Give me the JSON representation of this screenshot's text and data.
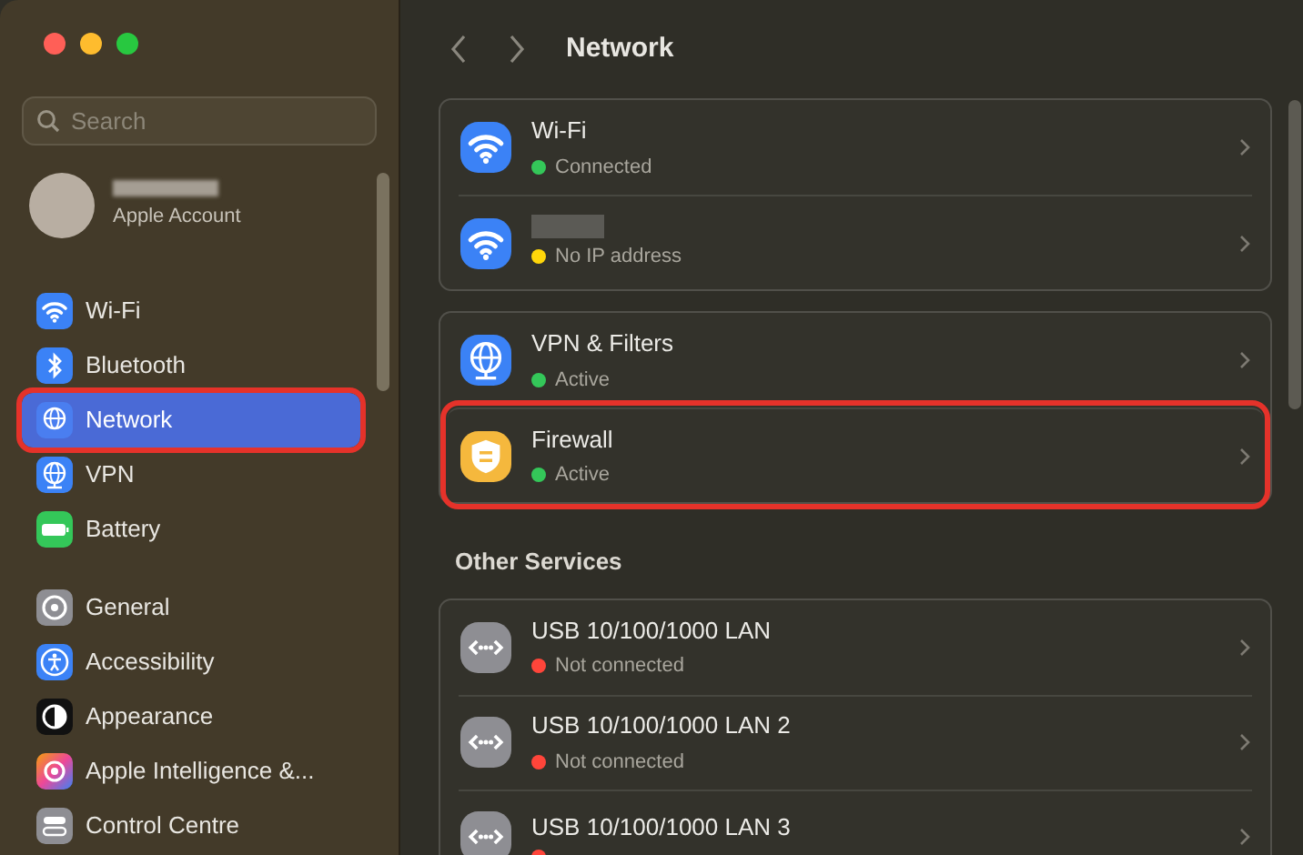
{
  "search": {
    "placeholder": "Search"
  },
  "account": {
    "label": "Apple Account"
  },
  "sidebar": {
    "groups": [
      [
        {
          "kind": "wifi",
          "label": "Wi-Fi",
          "selected": false,
          "highlighted": false
        },
        {
          "kind": "bluetooth",
          "label": "Bluetooth",
          "selected": false,
          "highlighted": false
        },
        {
          "kind": "network",
          "label": "Network",
          "selected": true,
          "highlighted": true
        },
        {
          "kind": "vpn",
          "label": "VPN",
          "selected": false,
          "highlighted": false
        },
        {
          "kind": "battery",
          "label": "Battery",
          "selected": false,
          "highlighted": false
        }
      ],
      [
        {
          "kind": "general",
          "label": "General",
          "selected": false,
          "highlighted": false
        },
        {
          "kind": "accessibility",
          "label": "Accessibility",
          "selected": false,
          "highlighted": false
        },
        {
          "kind": "appearance",
          "label": "Appearance",
          "selected": false,
          "highlighted": false
        },
        {
          "kind": "intelligence",
          "label": "Apple Intelligence &...",
          "selected": false,
          "highlighted": false
        },
        {
          "kind": "control",
          "label": "Control Centre",
          "selected": false,
          "highlighted": false
        }
      ]
    ]
  },
  "header": {
    "title": "Network"
  },
  "cards": [
    {
      "rows": [
        {
          "kind": "wifi",
          "name": "Wi-Fi",
          "status": "Connected",
          "color": "#34c759",
          "highlighted": false
        },
        {
          "kind": "wifi",
          "name_redacted": true,
          "status": "No IP address",
          "color": "#ffd60a",
          "highlighted": false
        }
      ]
    },
    {
      "rows": [
        {
          "kind": "vpn",
          "name": "VPN & Filters",
          "status": "Active",
          "color": "#34c759",
          "highlighted": false
        },
        {
          "kind": "firewall",
          "name": "Firewall",
          "status": "Active",
          "color": "#34c759",
          "highlighted": true
        }
      ]
    },
    {
      "heading": "Other Services",
      "rows": [
        {
          "kind": "ethernet",
          "name": "USB 10/100/1000 LAN",
          "status": "Not connected",
          "color": "#ff453a",
          "highlighted": false
        },
        {
          "kind": "ethernet",
          "name": "USB 10/100/1000 LAN 2",
          "status": "Not connected",
          "color": "#ff453a",
          "highlighted": false
        },
        {
          "kind": "ethernet",
          "name": "USB 10/100/1000 LAN 3",
          "color": "#ff453a",
          "highlighted": false
        }
      ]
    }
  ]
}
